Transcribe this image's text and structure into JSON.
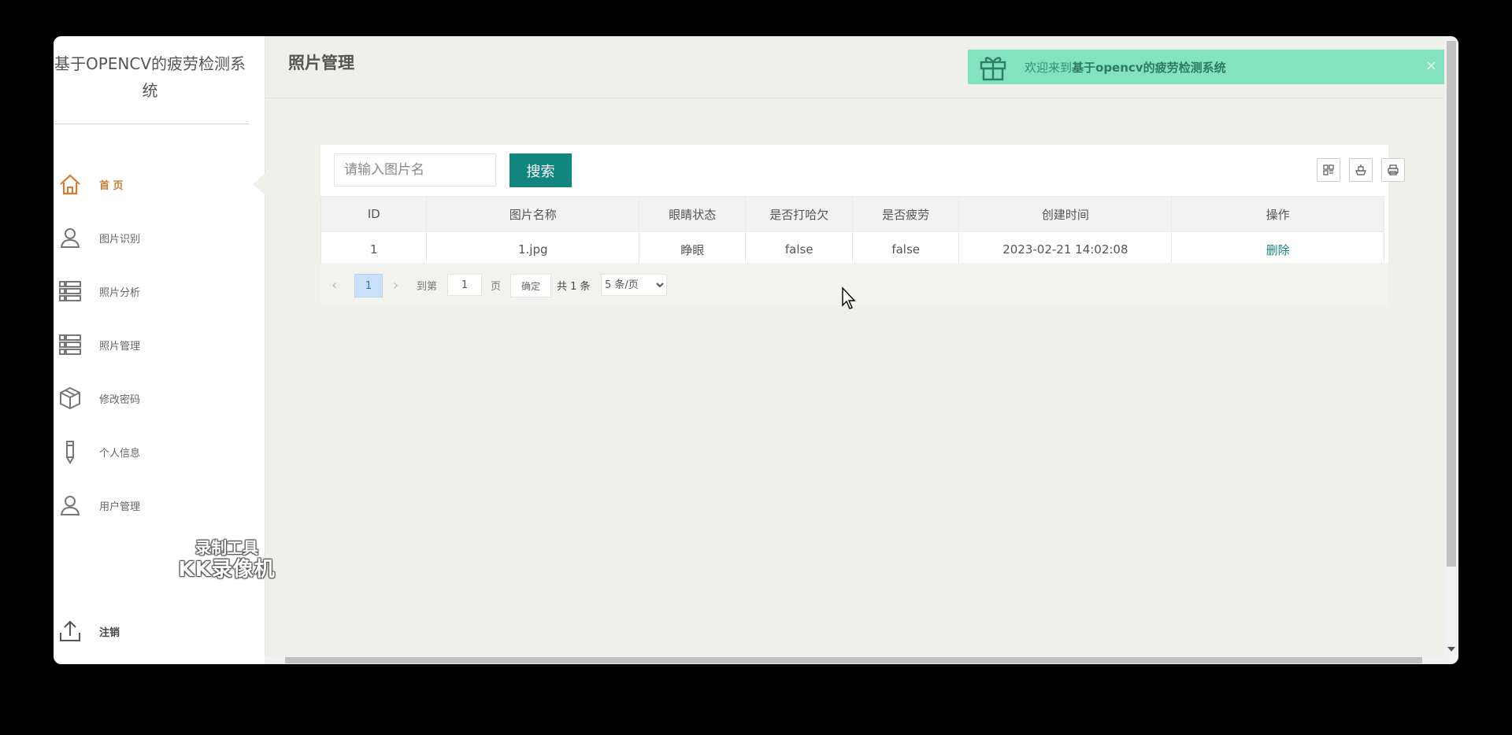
{
  "sidebar": {
    "brand": "基于OPENCV的疲劳检测系统",
    "items": [
      {
        "label": "首 页",
        "icon": "home-icon",
        "active": true
      },
      {
        "label": "图片识别",
        "icon": "user-icon"
      },
      {
        "label": "照片分析",
        "icon": "list-icon"
      },
      {
        "label": "照片管理",
        "icon": "list-icon"
      },
      {
        "label": "修改密码",
        "icon": "cube-icon"
      },
      {
        "label": "个人信息",
        "icon": "pencil-icon"
      },
      {
        "label": "用户管理",
        "icon": "user-icon"
      }
    ],
    "logout": "注销",
    "watermark_line1": "录制工具",
    "watermark_line2": "KK录像机"
  },
  "header": {
    "title": "照片管理",
    "welcome_prefix": "欢迎来到",
    "welcome_bold": "基于opencv的疲劳检测系统",
    "close": "×"
  },
  "search": {
    "placeholder": "请输入图片名",
    "button": "搜索"
  },
  "toolbar": [
    "columns-icon",
    "export-icon",
    "print-icon"
  ],
  "table": {
    "headers": [
      "ID",
      "图片名称",
      "眼睛状态",
      "是否打哈欠",
      "是否疲劳",
      "创建时间",
      "操作"
    ],
    "rows": [
      {
        "id": "1",
        "name": "1.jpg",
        "eye": "睁眼",
        "yawn": "false",
        "fatigue": "false",
        "created": "2023-02-21 14:02:08",
        "action": "删除"
      }
    ]
  },
  "pager": {
    "prev": "‹",
    "current": "1",
    "next": "›",
    "goto_label": "到第",
    "goto_value": "1",
    "page_unit": "页",
    "confirm": "确定",
    "total": "共 1 条",
    "page_size": "5 条/页"
  },
  "colors": {
    "accent": "#12857f",
    "active_nav": "#c87f3a",
    "welcome_bg": "#83e2bf"
  }
}
